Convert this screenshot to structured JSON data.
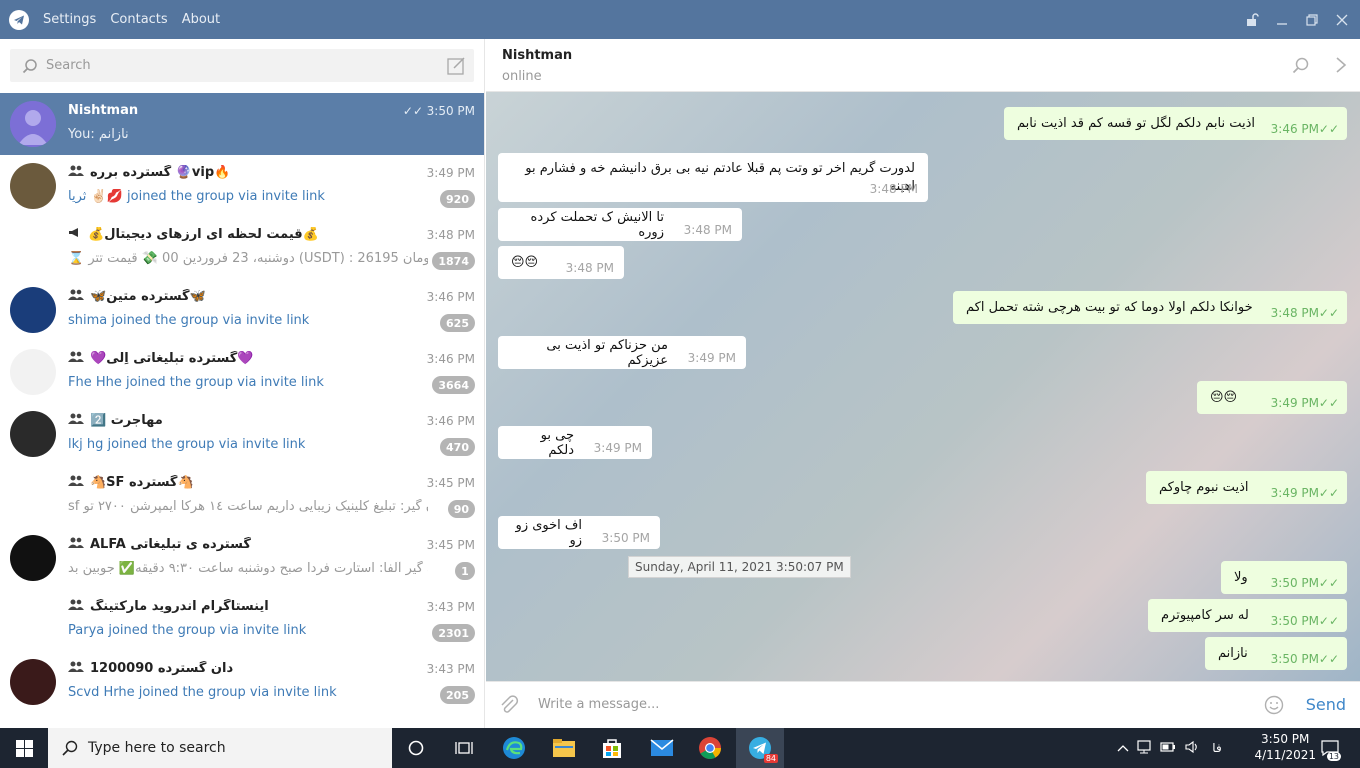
{
  "window": {
    "menu": [
      "Settings",
      "Contacts",
      "About"
    ]
  },
  "search": {
    "placeholder": "Search"
  },
  "chats": [
    {
      "name": "Nishtman",
      "time": "3:50 PM",
      "message": "You: نازانم",
      "active": true,
      "badge": "",
      "group": false,
      "avatar_color": "#7c6fd6"
    },
    {
      "name": "گسترده برره 🔮vip🔥",
      "time": "3:49 PM",
      "message": "ثریا ✌🏻💋 joined the group via invite link",
      "link": true,
      "badge": "920",
      "group": true,
      "avatar_color": "#6b5a3d"
    },
    {
      "name": "💰قیمت لحظه ای ارزهای دیجیتال💰",
      "time": "3:48 PM",
      "message": "⌛ دوشنبه، 23 فروردین 00 💸 قیمت تتر (USDT) : 26195 تومان...",
      "badge": "1874",
      "group": false,
      "channel": true,
      "avatar_color": "#ffffff"
    },
    {
      "name": "🦋گسترده متین🦋",
      "time": "3:46 PM",
      "message": "shima joined the group via invite link",
      "link": true,
      "badge": "625",
      "group": true,
      "avatar_color": "#1a3d7a"
    },
    {
      "name": "💜گسترده تبلیغاتی اِلی💜",
      "time": "3:46 PM",
      "message": "Fhe Hhe joined the group via invite link",
      "link": true,
      "badge": "3664",
      "group": true,
      "avatar_color": "#f2f2f2"
    },
    {
      "name": "مهاجرت 2️⃣",
      "time": "3:46 PM",
      "message": "lkj hg joined the group via invite link",
      "link": true,
      "badge": "470",
      "group": true,
      "avatar_color": "#2a2a2a"
    },
    {
      "name": "🐴SF گسترده🐴",
      "time": "3:45 PM",
      "message": "sf دان گیر: تبلیغ کلینیک زیبایی داریم ساعت ١٤ هرکا ایمپرشن ٢٧٠٠ تو...",
      "badge": "90",
      "group": true,
      "avatar_color": "#ffffff"
    },
    {
      "name": "ALFA گسترده ی تبلیغاتی",
      "time": "3:45 PM",
      "message": "دان گیر آلفا: استارت فردا صبح دوشنبه ساعت ۹:۳۰ دقیقه✅ جوبین بد...",
      "badge": "1",
      "group": true,
      "avatar_color": "#111111"
    },
    {
      "name": "اینستاگرام اندروید مارکتینگ",
      "time": "3:43 PM",
      "message": "Parya joined the group via invite link",
      "link": true,
      "badge": "2301",
      "group": true,
      "avatar_color": "#ffffff"
    },
    {
      "name": "دان گسترده 1200090",
      "time": "3:43 PM",
      "message": "Scvd Hrhe joined the group via invite link",
      "link": true,
      "badge": "205",
      "group": true,
      "avatar_color": "#3a1a1a"
    }
  ],
  "chat_header": {
    "title": "Nishtman",
    "status": "online"
  },
  "messages": [
    {
      "dir": "out",
      "text": "اذیت نابم دلکم لگل تو قسه کم قد اذیت نابم",
      "time": "3:46 PM"
    },
    {
      "dir": "in",
      "text": "لدورت گریم اخر تو وتت پم قبلا عادتم نیه بی برق دانیشم خه و فشارم بو اهینه",
      "time": "3:48 PM"
    },
    {
      "dir": "in",
      "text": "تا الانیش ک تحملت کرده زوره",
      "time": "3:48 PM"
    },
    {
      "dir": "in",
      "text": "😔😔",
      "time": "3:48 PM"
    },
    {
      "dir": "out",
      "text": "خوانکا دلکم اولا دوما که تو بیت هرچی شته تحمل اکم",
      "time": "3:48 PM"
    },
    {
      "dir": "in",
      "text": "من حزناکم تو اذیت بی عزیزکم",
      "time": "3:49 PM"
    },
    {
      "dir": "out",
      "text": "😔😔",
      "time": "3:49 PM"
    },
    {
      "dir": "in",
      "text": "چی بو دلکم",
      "time": "3:49 PM"
    },
    {
      "dir": "out",
      "text": "اذیت نبوم چاوکم",
      "time": "3:49 PM"
    },
    {
      "dir": "in",
      "text": "اف اخوی زو زو",
      "time": "3:50 PM"
    },
    {
      "dir": "out",
      "text": "ولا",
      "time": "3:50 PM"
    },
    {
      "dir": "out",
      "text": "له سر کامپیوترم",
      "time": "3:50 PM"
    },
    {
      "dir": "out",
      "text": "نازانم",
      "time": "3:50 PM"
    }
  ],
  "date_tooltip": "Sunday, April 11, 2021 3:50:07 PM",
  "composer": {
    "placeholder": "Write a message...",
    "send_label": "Send"
  },
  "taskbar": {
    "search_placeholder": "Type here to search",
    "telegram_badge": "84",
    "language": "فا",
    "time": "3:50 PM",
    "date": "4/11/2021",
    "notifications": "13"
  }
}
